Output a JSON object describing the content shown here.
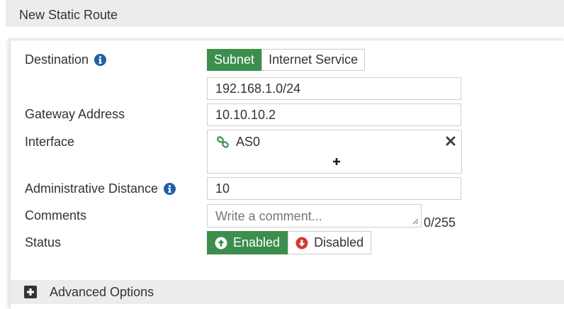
{
  "header": {
    "title": "New Static Route"
  },
  "form": {
    "destination": {
      "label": "Destination",
      "tabs": [
        {
          "label": "Subnet",
          "active": true
        },
        {
          "label": "Internet Service",
          "active": false
        }
      ],
      "value": "192.168.1.0/24"
    },
    "gateway": {
      "label": "Gateway Address",
      "value": "10.10.10.2"
    },
    "interface": {
      "label": "Interface",
      "selected": "AS0"
    },
    "admin_distance": {
      "label": "Administrative Distance",
      "value": "10"
    },
    "comments": {
      "label": "Comments",
      "placeholder": "Write a comment...",
      "counter": "0/255"
    },
    "status": {
      "label": "Status",
      "options": [
        {
          "label": "Enabled",
          "active": true
        },
        {
          "label": "Disabled",
          "active": false
        }
      ]
    }
  },
  "advanced": {
    "label": "Advanced Options"
  },
  "colors": {
    "accent": "#3c8e4c",
    "info": "#1d5fa8",
    "danger": "#d23a2e",
    "header_bg": "#ececec"
  }
}
